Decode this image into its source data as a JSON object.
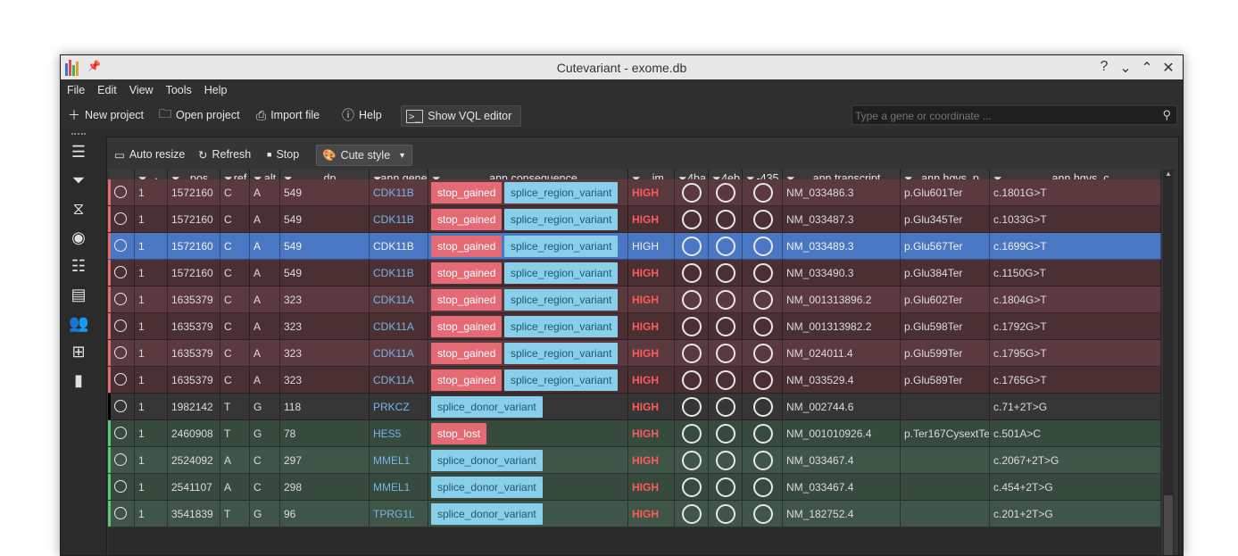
{
  "window": {
    "title": "Cutevariant - exome.db"
  },
  "menu": [
    "File",
    "Edit",
    "View",
    "Tools",
    "Help"
  ],
  "toolbar": {
    "new_project": "New project",
    "open_project": "Open project",
    "import_file": "Import file",
    "help": "Help",
    "vql": "Show VQL editor",
    "search_placeholder": "Type a gene or coordinate ..."
  },
  "sidebar_icons": [
    "view-list-icon",
    "filter-icon",
    "dna-icon",
    "palette-icon",
    "list-icon",
    "clipboard-icon",
    "users-icon",
    "table-icon",
    "book-icon"
  ],
  "panel_toolbar": {
    "auto_resize": "Auto resize",
    "refresh": "Refresh",
    "stop": "Stop",
    "style": "Cute style"
  },
  "columns": [
    "",
    "pos",
    "ref",
    "alt",
    "dp",
    "ann.gene",
    "ann.consequence",
    ".impact",
    "4ba",
    "4eb",
    "-435",
    "ann.transcript",
    "ann.hgvs_p",
    "ann.hgvs_c"
  ],
  "column_labels_shown": [
    "·",
    "pos",
    "ref",
    "alt",
    "dp",
    "ann.gene",
    "ann.consequence",
    ".im",
    "4ba",
    "4eb",
    "-435",
    "ann.transcript",
    "ann.hgvs_p",
    "ann.hgvs_c"
  ],
  "colors": {
    "high_impact_row_a": "#5a3a3e",
    "high_impact_row_b": "#4a3033",
    "selected_row": "#4a77c4",
    "green_row_a": "#3f5547",
    "green_row_b": "#364a3d",
    "neutral_row": "#363636",
    "bar_red": "#e46a75",
    "bar_green": "#5dc878",
    "bar_black": "#000000"
  },
  "rows": [
    {
      "chr": "1",
      "pos": "1572160",
      "ref": "C",
      "alt": "A",
      "dp": "549",
      "gene": "CDK11B",
      "cons": [
        "stop_gained",
        "splice_region_variant"
      ],
      "impact": "HIGH",
      "transcript": "NM_033486.3",
      "hgvs_p": "p.Glu601Ter",
      "hgvs_c": "c.1801G>T",
      "theme": "red_a"
    },
    {
      "chr": "1",
      "pos": "1572160",
      "ref": "C",
      "alt": "A",
      "dp": "549",
      "gene": "CDK11B",
      "cons": [
        "stop_gained",
        "splice_region_variant"
      ],
      "impact": "HIGH",
      "transcript": "NM_033487.3",
      "hgvs_p": "p.Glu345Ter",
      "hgvs_c": "c.1033G>T",
      "theme": "red_b"
    },
    {
      "chr": "1",
      "pos": "1572160",
      "ref": "C",
      "alt": "A",
      "dp": "549",
      "gene": "CDK11B",
      "cons": [
        "stop_gained",
        "splice_region_variant"
      ],
      "impact": "HIGH",
      "transcript": "NM_033489.3",
      "hgvs_p": "p.Glu567Ter",
      "hgvs_c": "c.1699G>T",
      "theme": "selected"
    },
    {
      "chr": "1",
      "pos": "1572160",
      "ref": "C",
      "alt": "A",
      "dp": "549",
      "gene": "CDK11B",
      "cons": [
        "stop_gained",
        "splice_region_variant"
      ],
      "impact": "HIGH",
      "transcript": "NM_033490.3",
      "hgvs_p": "p.Glu384Ter",
      "hgvs_c": "c.1150G>T",
      "theme": "red_b"
    },
    {
      "chr": "1",
      "pos": "1635379",
      "ref": "C",
      "alt": "A",
      "dp": "323",
      "gene": "CDK11A",
      "cons": [
        "stop_gained",
        "splice_region_variant"
      ],
      "impact": "HIGH",
      "transcript": "NM_001313896.2",
      "hgvs_p": "p.Glu602Ter",
      "hgvs_c": "c.1804G>T",
      "theme": "red_a"
    },
    {
      "chr": "1",
      "pos": "1635379",
      "ref": "C",
      "alt": "A",
      "dp": "323",
      "gene": "CDK11A",
      "cons": [
        "stop_gained",
        "splice_region_variant"
      ],
      "impact": "HIGH",
      "transcript": "NM_001313982.2",
      "hgvs_p": "p.Glu598Ter",
      "hgvs_c": "c.1792G>T",
      "theme": "red_b"
    },
    {
      "chr": "1",
      "pos": "1635379",
      "ref": "C",
      "alt": "A",
      "dp": "323",
      "gene": "CDK11A",
      "cons": [
        "stop_gained",
        "splice_region_variant"
      ],
      "impact": "HIGH",
      "transcript": "NM_024011.4",
      "hgvs_p": "p.Glu599Ter",
      "hgvs_c": "c.1795G>T",
      "theme": "red_a"
    },
    {
      "chr": "1",
      "pos": "1635379",
      "ref": "C",
      "alt": "A",
      "dp": "323",
      "gene": "CDK11A",
      "cons": [
        "stop_gained",
        "splice_region_variant"
      ],
      "impact": "HIGH",
      "transcript": "NM_033529.4",
      "hgvs_p": "p.Glu589Ter",
      "hgvs_c": "c.1765G>T",
      "theme": "red_b"
    },
    {
      "chr": "1",
      "pos": "1982142",
      "ref": "T",
      "alt": "G",
      "dp": "118",
      "gene": "PRKCZ",
      "cons": [
        "splice_donor_variant"
      ],
      "impact": "HIGH",
      "transcript": "NM_002744.6",
      "hgvs_p": "",
      "hgvs_c": "c.71+2T>G",
      "theme": "neutral"
    },
    {
      "chr": "1",
      "pos": "2460908",
      "ref": "T",
      "alt": "G",
      "dp": "78",
      "gene": "HES5",
      "cons": [
        "stop_lost"
      ],
      "impact": "HIGH",
      "transcript": "NM_001010926.4",
      "hgvs_p": "p.Ter167CysextTer",
      "hgvs_c": "c.501A>C",
      "theme": "green_b"
    },
    {
      "chr": "1",
      "pos": "2524092",
      "ref": "A",
      "alt": "C",
      "dp": "297",
      "gene": "MMEL1",
      "cons": [
        "splice_donor_variant"
      ],
      "impact": "HIGH",
      "transcript": "NM_033467.4",
      "hgvs_p": "",
      "hgvs_c": "c.2067+2T>G",
      "theme": "green_a"
    },
    {
      "chr": "1",
      "pos": "2541107",
      "ref": "A",
      "alt": "C",
      "dp": "298",
      "gene": "MMEL1",
      "cons": [
        "splice_donor_variant"
      ],
      "impact": "HIGH",
      "transcript": "NM_033467.4",
      "hgvs_p": "",
      "hgvs_c": "c.454+2T>G",
      "theme": "green_b"
    },
    {
      "chr": "1",
      "pos": "3541839",
      "ref": "T",
      "alt": "G",
      "dp": "96",
      "gene": "TPRG1L",
      "cons": [
        "splice_donor_variant"
      ],
      "impact": "HIGH",
      "transcript": "NM_182752.4",
      "hgvs_p": "",
      "hgvs_c": "c.201+2T>G",
      "theme": "green_a"
    }
  ]
}
